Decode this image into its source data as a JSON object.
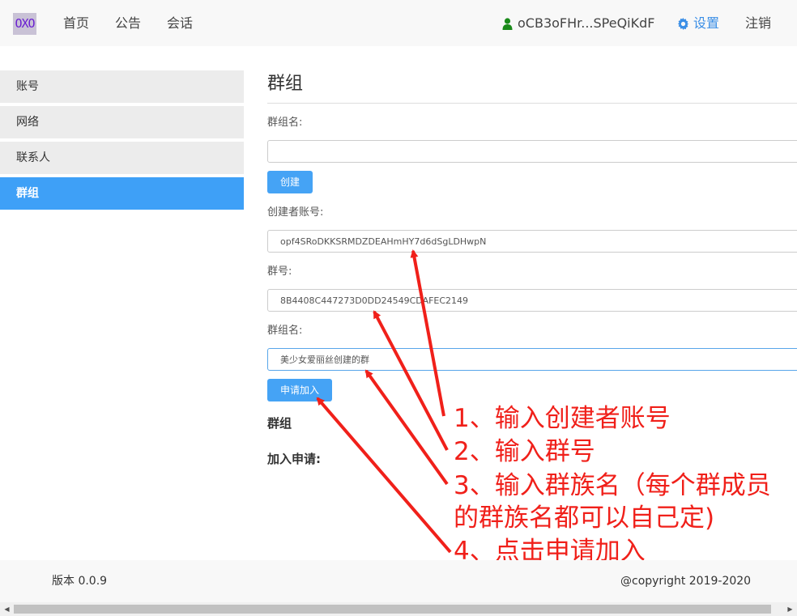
{
  "nav": {
    "logo": "OXO",
    "links": [
      "首页",
      "公告",
      "会话"
    ],
    "user": "oCB3oFHr...SPeQiKdF",
    "settings": "设置",
    "logout": "注销"
  },
  "sidebar": {
    "items": [
      {
        "label": "账号"
      },
      {
        "label": "网络"
      },
      {
        "label": "联系人"
      },
      {
        "label": "群组",
        "active": true
      }
    ]
  },
  "main": {
    "title": "群组",
    "create": {
      "group_name_label": "群组名:",
      "group_name_value": "",
      "create_button": "创建"
    },
    "join": {
      "creator_label": "创建者账号:",
      "creator_value": "opf4SRoDKKSRMDZDEAHmHY7d6dSgLDHwpN",
      "group_id_label": "群号:",
      "group_id_value": "8B4408C447273D0DD24549CDAFEC2149",
      "group_name_label": "群组名:",
      "group_name_value": "美少女爱丽丝创建的群",
      "apply_button": "申请加入"
    },
    "groups_heading": "群组",
    "requests_heading": "加入申请:"
  },
  "annotations": {
    "color": "#f0201a",
    "step1": "1、输入创建者账号",
    "step2": "2、输入群号",
    "step3_line1": "3、输入群族名（每个群成员",
    "step3_line2": "的群族名都可以自己定)",
    "step4": "4、点击申请加入"
  },
  "footer": {
    "version": "版本 0.0.9",
    "copyright": "@copyright 2019-2020"
  },
  "colors": {
    "accent": "#45a3f5",
    "active_sidebar": "#3ea0f7",
    "settings_link": "#3a8ee6",
    "user_icon": "#1a8a1a"
  }
}
